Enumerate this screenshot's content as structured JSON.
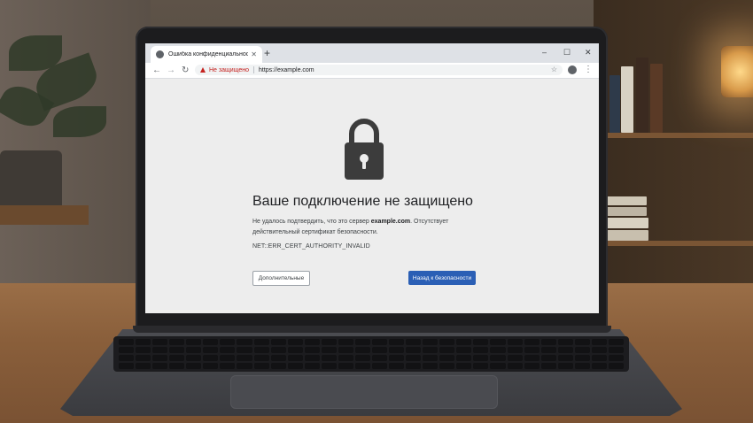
{
  "browser": {
    "tab_title": "Ошибка конфиденциальности",
    "new_tab": "+",
    "window_controls": {
      "minimize": "–",
      "maximize": "☐",
      "close": "✕"
    },
    "nav": {
      "back": "←",
      "forward": "→",
      "reload": "↻"
    },
    "security_label": "Не защищено",
    "url": "https://example.com",
    "menu": "⋮",
    "star": "☆"
  },
  "error_page": {
    "title": "Ваше подключение не защищено",
    "desc_prefix": "Не удалось подтвердить, что это сервер ",
    "desc_domain": "example.com",
    "desc_suffix": ". Отсутствует действительный сертификат безопасности.",
    "error_code": "NET::ERR_CERT_AUTHORITY_INVALID",
    "advanced_button": "Дополнительные",
    "back_button": "Назад к безопасности"
  },
  "colors": {
    "accent_button": "#2b5fb5",
    "warning": "#c5221f",
    "lock_icon": "#3c3c3c"
  },
  "icons": {
    "tab": "globe-icon",
    "security": "warning-triangle-icon",
    "lock": "lock-icon",
    "profile": "account-icon"
  }
}
